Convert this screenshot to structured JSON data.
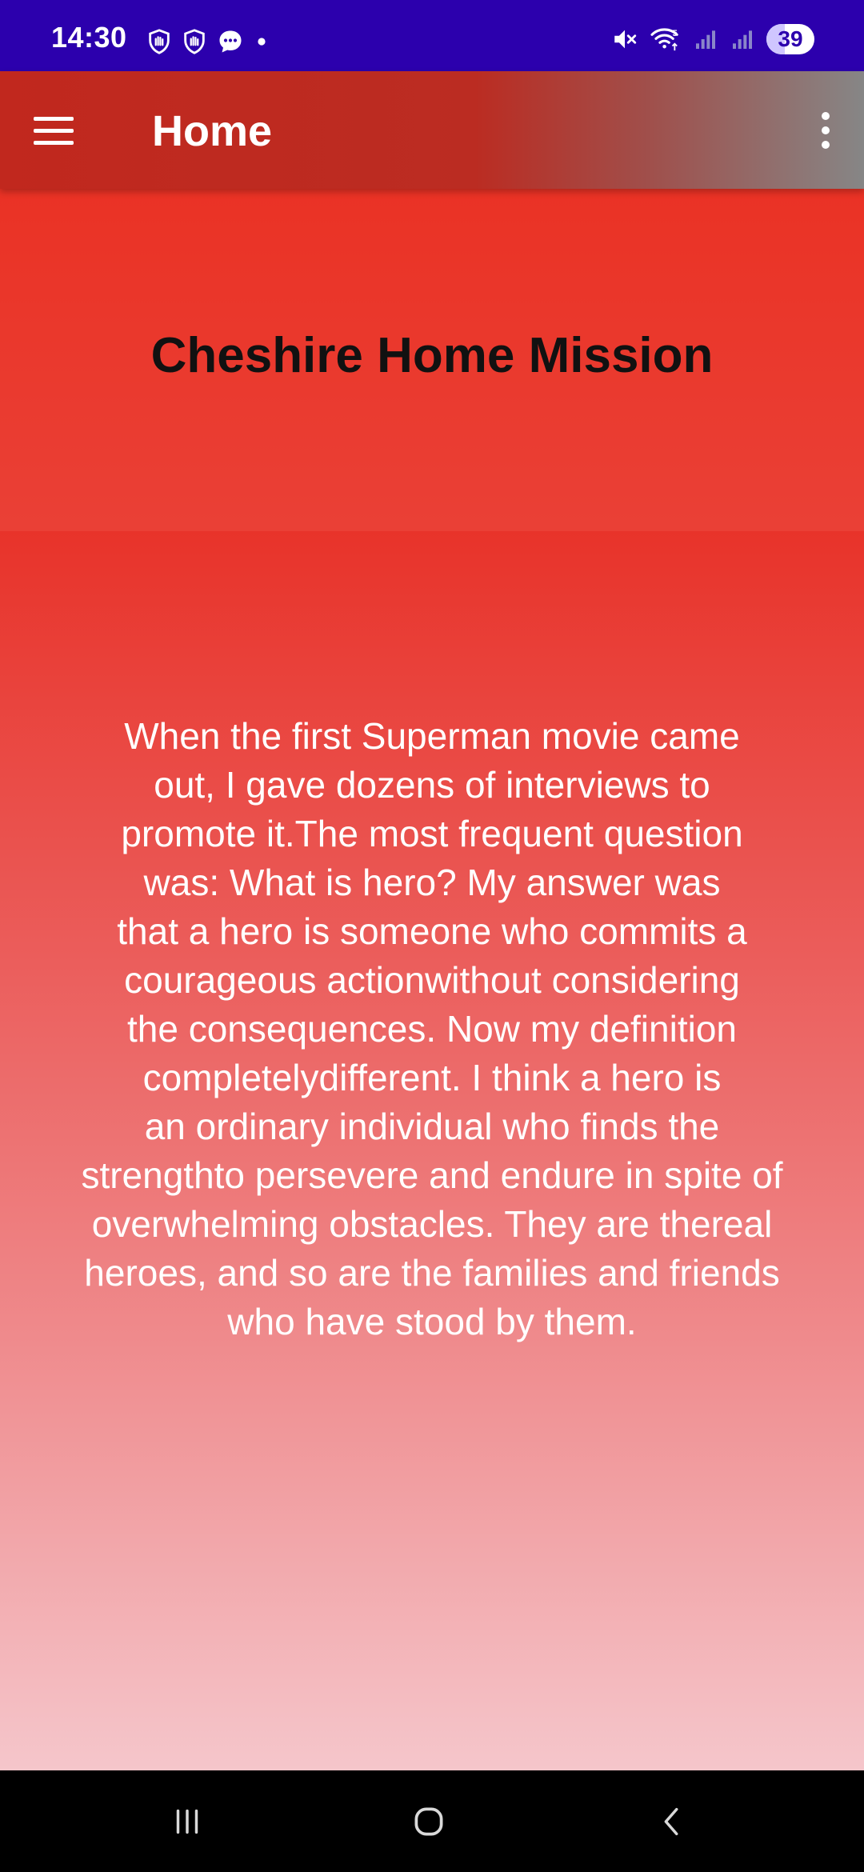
{
  "status_bar": {
    "time": "14:30",
    "left_icons": [
      "hand-shield-icon",
      "hand-shield-icon",
      "chat-bubble-icon",
      "dot-icon"
    ],
    "right_icons": [
      "mute-icon",
      "wifi-5-icon",
      "signal-icon",
      "signal-icon"
    ],
    "battery": "39",
    "battery_level_percent": 39
  },
  "app_bar": {
    "title": "Home",
    "menu_icon": "menu-icon",
    "overflow_icon": "more-vert-icon"
  },
  "header": {
    "title": "Cheshire Home Mission"
  },
  "content": {
    "text": "When the first Superman movie came\nout, I gave dozens of interviews to\npromote it.The most frequent question\nwas: What is hero? My answer was\nthat a hero is someone who commits a\ncourageous actionwithout considering\nthe consequences. Now my definition\ncompletelydifferent. I think a hero is\nan ordinary individual who finds the\nstrengthto persevere and endure in spite of\noverwhelming obstacles. They are thereal\nheroes, and so are the families and friends\nwho have stood by them."
  },
  "nav_bar": {
    "buttons": [
      "recents-icon",
      "home-icon",
      "back-icon"
    ]
  },
  "colors": {
    "status_bar": "#2c00ad",
    "app_bar": "#c1281e",
    "header_bg": "#ea3225",
    "content_top": "#e8332a",
    "content_bottom": "#f5c6cb"
  }
}
